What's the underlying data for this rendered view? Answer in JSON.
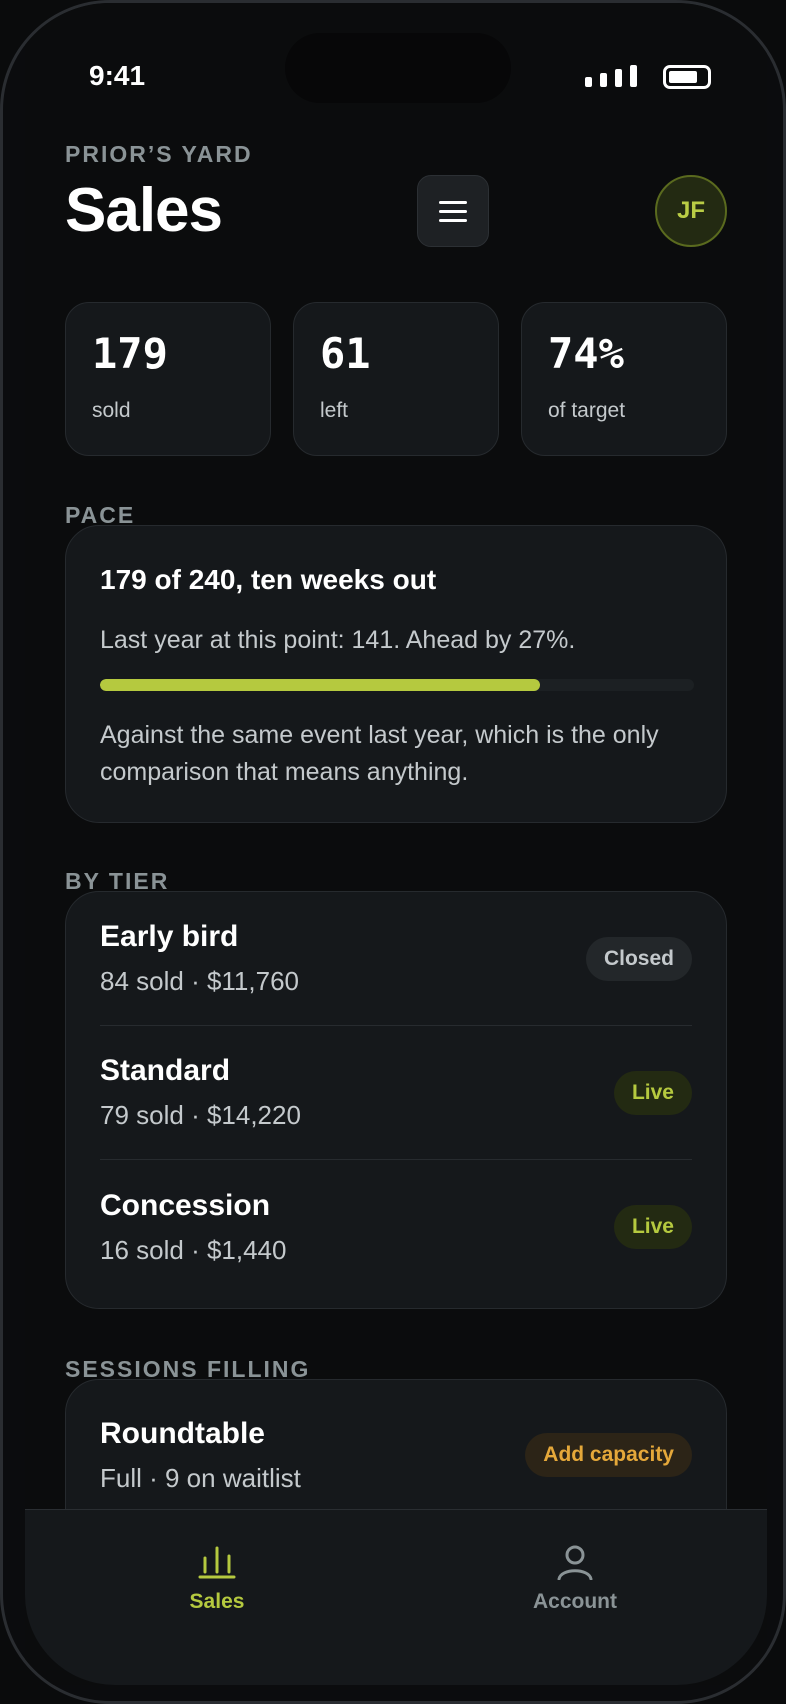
{
  "status_bar": {
    "time": "9:41"
  },
  "header": {
    "eyebrow": "PRIOR’S YARD",
    "title": "Sales",
    "avatar_initials": "JF"
  },
  "stats": [
    {
      "value": "179",
      "label": "sold"
    },
    {
      "value": "61",
      "label": "left"
    },
    {
      "value": "74%",
      "label": "of target"
    }
  ],
  "pace": {
    "section_label": "PACE",
    "headline": "179 of 240, ten weeks out",
    "subline": "Last year at this point: 141. Ahead by 27%.",
    "progress_fraction": 0.74,
    "note": "Against the same event last year, which is the only comparison that means anything."
  },
  "tiers": {
    "section_label": "BY TIER",
    "items": [
      {
        "name": "Early bird",
        "meta": "84 sold · $11,760",
        "status": "Closed"
      },
      {
        "name": "Standard",
        "meta": "79 sold · $14,220",
        "status": "Live"
      },
      {
        "name": "Concession",
        "meta": "16 sold · $1,440",
        "status": "Live"
      }
    ]
  },
  "sessions": {
    "section_label": "SESSIONS FILLING",
    "items": [
      {
        "name": "Roundtable",
        "meta": "Full · 9 on waitlist",
        "action": "Add capacity"
      }
    ]
  },
  "tabbar": {
    "tabs": [
      {
        "label": "Sales",
        "icon": "bar-chart-icon",
        "active": true
      },
      {
        "label": "Account",
        "icon": "person-icon",
        "active": false
      }
    ]
  },
  "colors": {
    "accent": "#b5c93f",
    "warning": "#e5a83a",
    "background": "#0b0c0d",
    "card": "#15181b"
  }
}
